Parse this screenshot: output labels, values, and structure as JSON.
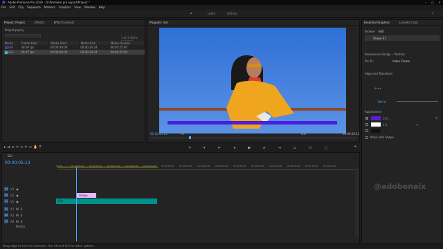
{
  "window": {
    "title": "Adobe Premiere Pro 2019 - D:\\Premiere pro export\\Project *"
  },
  "menu": [
    "File",
    "Edit",
    "Clip",
    "Sequence",
    "Markers",
    "Graphics",
    "View",
    "Window",
    "Help"
  ],
  "workspace": {
    "active": "Learn",
    "editing": "Editing"
  },
  "project": {
    "tabs": [
      "Project: Project",
      "Effects",
      "Effect Controls"
    ],
    "path": "Project.prproj",
    "selected": "1 of 3 items selected",
    "columns": [
      "Name",
      "Frame Rate",
      "Media Start",
      "Media End",
      "Media Duratio"
    ],
    "rows": [
      {
        "color": "#5c2fc4",
        "name": "Girl",
        "rate": "30.00 fps",
        "start": "00:00:00:00",
        "end": "00:00:24:24",
        "dur": "00:00:25:00"
      },
      {
        "color": "#2dc9a8",
        "name": "Girl",
        "rate": "29.97 fps",
        "start": "00:00:00:00",
        "end": "00:00:24:24",
        "dur": "00:00:25:00"
      }
    ]
  },
  "program": {
    "tab": "Program: Girl",
    "timecode": "00:00:05:13",
    "fit": "Fit",
    "full": "Full",
    "duration": "00:00:26:12"
  },
  "essential": {
    "tabs": [
      "Essential Graphics",
      "Lumetri Color"
    ],
    "subtabs": [
      "Browse",
      "Edit"
    ],
    "layer": "Shape 01",
    "responsive": "Responsive Design – Position",
    "pin": "Pin To:",
    "pinval": "Video Frame",
    "align": "Align and Transform",
    "appearance": "Appearance",
    "mask": "Mask with Shape",
    "fill_hex": "5B0...",
    "opacity": "100 %",
    "stroke": "1.0"
  },
  "timeline": {
    "name": "Girl",
    "timecode": "00:00:05:13",
    "clip1": "Shape",
    "clip2": "Girl",
    "master": "Master",
    "ticks": [
      "00:00",
      "00:00:05:00",
      "00:00:10:00",
      "00:00:15:00",
      "00:00:20:00",
      "00:00:25:00",
      "00:00:30:00",
      "00:00:35:00",
      "00:00:40:00",
      "00:00:45:00",
      "00:00:50:00",
      "00:00:55:00",
      "00:01:00:00",
      "00:01:05:00",
      "00:01:10:00",
      "00:01:15:00"
    ],
    "tracks": [
      "V3",
      "V2",
      "V1",
      "A1",
      "A2",
      "A3"
    ]
  },
  "status": "Drag edge to trim the selection. Use Alt and Ctrl for other options.",
  "watermark": "@adobenaix",
  "colors": {
    "accent": "#4fa3ff",
    "bar": "#4b1de0",
    "teal": "#00918a",
    "pink": "#e8b6ff"
  }
}
